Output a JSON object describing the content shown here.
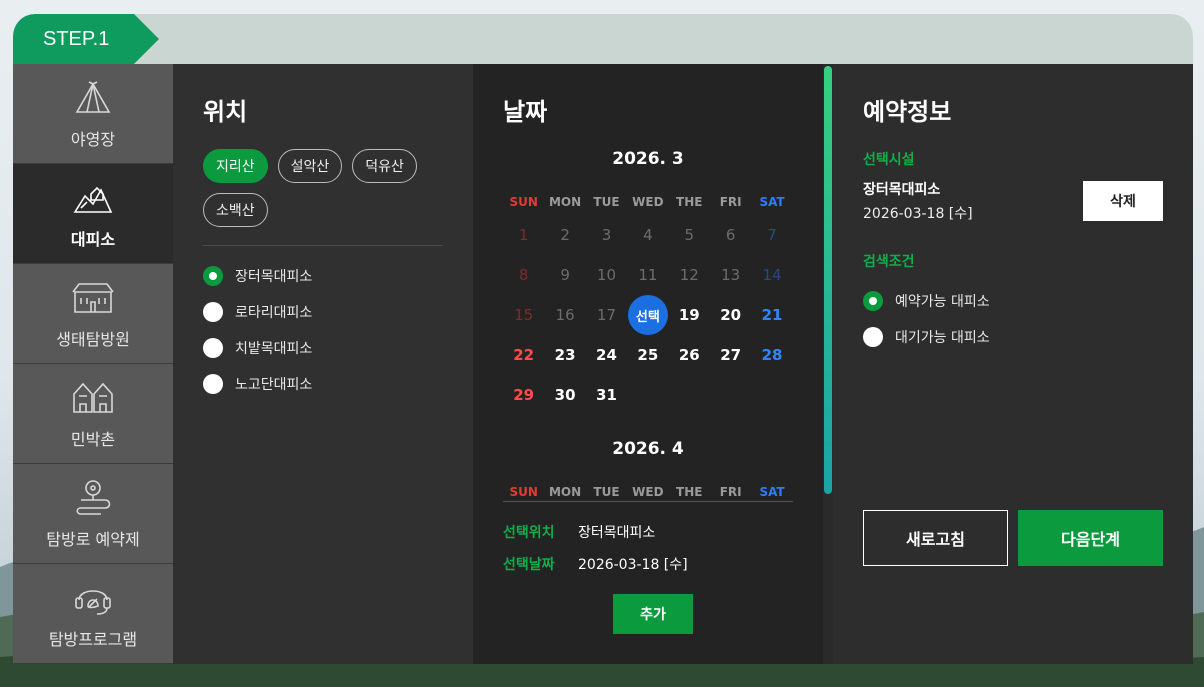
{
  "step": {
    "label": "STEP.1"
  },
  "nav": {
    "items": [
      {
        "label": "야영장",
        "icon": "tent-icon"
      },
      {
        "label": "대피소",
        "icon": "mountain-shelter-icon",
        "active": true
      },
      {
        "label": "생태탐방원",
        "icon": "building-icon"
      },
      {
        "label": "민박촌",
        "icon": "houses-icon"
      },
      {
        "label": "탐방로 예약제",
        "icon": "trail-pin-icon"
      },
      {
        "label": "탐방프로그램",
        "icon": "headset-leaf-icon"
      }
    ]
  },
  "location": {
    "title": "위치",
    "mountains": [
      "지리산",
      "설악산",
      "덕유산",
      "소백산"
    ],
    "selected_mountain": "지리산",
    "shelters": [
      "장터목대피소",
      "로타리대피소",
      "치밭목대피소",
      "노고단대피소"
    ],
    "selected_shelter": "장터목대피소"
  },
  "date": {
    "title": "날짜",
    "weekdays": [
      "SUN",
      "MON",
      "TUE",
      "WED",
      "THE",
      "FRI",
      "SAT"
    ],
    "month1": {
      "title": "2026. 3",
      "days": [
        "1",
        "2",
        "3",
        "4",
        "5",
        "6",
        "7",
        "8",
        "9",
        "10",
        "11",
        "12",
        "13",
        "14",
        "15",
        "16",
        "17",
        "선택",
        "19",
        "20",
        "21",
        "22",
        "23",
        "24",
        "25",
        "26",
        "27",
        "28",
        "29",
        "30",
        "31"
      ],
      "past_until": 17,
      "selected_index": 18
    },
    "month2": {
      "title": "2026. 4"
    },
    "selection": {
      "location_key": "선택위치",
      "location_value": "장터목대피소",
      "date_key": "선택날짜",
      "date_value": "2026-03-18 [수]"
    },
    "add_label": "추가"
  },
  "info": {
    "title": "예약정보",
    "facility_label": "선택시설",
    "facility_name": "장터목대피소",
    "facility_date": "2026-03-18 [수]",
    "delete_label": "삭제",
    "condition_label": "검색조건",
    "conditions": [
      "예약가능 대피소",
      "대기가능 대피소"
    ],
    "selected_condition": "예약가능 대피소",
    "refresh_label": "새로고침",
    "next_label": "다음단계"
  },
  "colors": {
    "accent": "#0c9a3e",
    "selected_day": "#1b6fe0",
    "sunday": "#ff4b4b",
    "saturday": "#2f86ff"
  }
}
